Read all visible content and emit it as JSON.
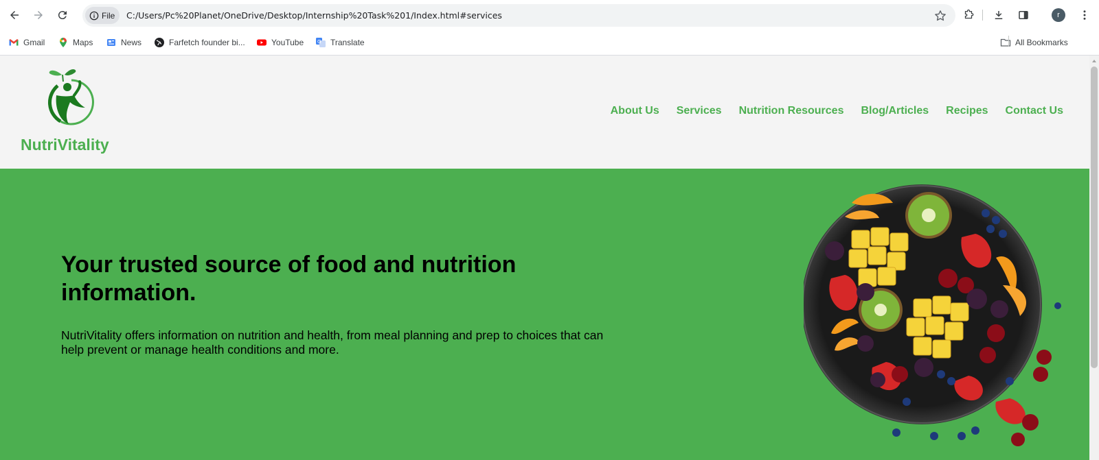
{
  "browser": {
    "security_chip": "File",
    "url": "C:/Users/Pc%20Planet/OneDrive/Desktop/Internship%20Task%201/Index.html#services",
    "profile_initial": "r"
  },
  "bookmarks": {
    "items": [
      {
        "label": "Gmail",
        "icon": "gmail-icon"
      },
      {
        "label": "Maps",
        "icon": "maps-icon"
      },
      {
        "label": "News",
        "icon": "news-icon"
      },
      {
        "label": "Farfetch founder bi...",
        "icon": "globe-icon"
      },
      {
        "label": "YouTube",
        "icon": "youtube-icon"
      },
      {
        "label": "Translate",
        "icon": "translate-icon"
      }
    ],
    "all_bookmarks": "All Bookmarks"
  },
  "site": {
    "brand": "NutriVitality",
    "nav": [
      "About Us",
      "Services",
      "Nutrition Resources",
      "Blog/Articles",
      "Recipes",
      "Contact Us"
    ],
    "hero": {
      "title": "Your trusted source of food and nutrition information.",
      "text": "NutriVitality offers information on nutrition and health, from meal planning and prep to choices that can help prevent or manage health conditions and more."
    }
  },
  "colors": {
    "brand_green": "#4caf50",
    "header_bg": "#f4f4f4",
    "logo_dark_green": "#1b7a1f"
  }
}
